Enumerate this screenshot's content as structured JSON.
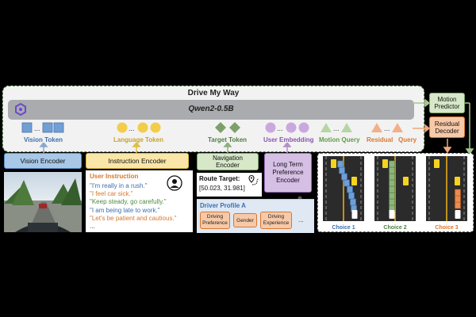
{
  "title": "Drive My Way",
  "llm_label": "Qwen2-0.5B",
  "token_labels": {
    "vision": "Vision Token",
    "language": "Language Token",
    "target": "Target Token",
    "user": "User Embedding",
    "motion_query": "Motion Query",
    "residual_query": "Residual   Query"
  },
  "encoders": {
    "vision": "Vision Encoder",
    "instruction": "Instruction Encoder",
    "navigation": "Navigation Encoder",
    "preference": "Long Term Preference Encoder"
  },
  "instruction_panel": {
    "heading": "User Instruction",
    "lines": [
      {
        "text": "\"I'm really in a rush.\"",
        "color": "#3b6fb0"
      },
      {
        "text": "\"I feel car sick.\"",
        "color": "#d8772f"
      },
      {
        "text": "\"Keep steady, go carefully.\"",
        "color": "#4e8a3b"
      },
      {
        "text": "\"I am being late to work.\"",
        "color": "#3b6fb0"
      },
      {
        "text": "\"Let's be patient and cautious.\"",
        "color": "#d8772f"
      },
      {
        "text": "...",
        "color": "#333333"
      }
    ]
  },
  "route": {
    "label": "Route Target:",
    "value": "[50.023, 31.981]"
  },
  "driver_profile": {
    "title": "Driver Profile A",
    "chips": [
      "Driving Preference",
      "Gender",
      "Driving Experience"
    ],
    "ellipsis": "..."
  },
  "heads": {
    "motion": "Motion Predictor",
    "residual": "Residual Decoder"
  },
  "choices": [
    "Choice 1",
    "Choice 2",
    "Choice 3"
  ],
  "colors": {
    "vision": "#6f9fd4",
    "language": "#f3cc4a",
    "target": "#7d9f6c",
    "user": "#b98fd0",
    "motion": "#b5d6a3",
    "residual": "#f2b08a",
    "llm_bar": "#a9abaf"
  }
}
